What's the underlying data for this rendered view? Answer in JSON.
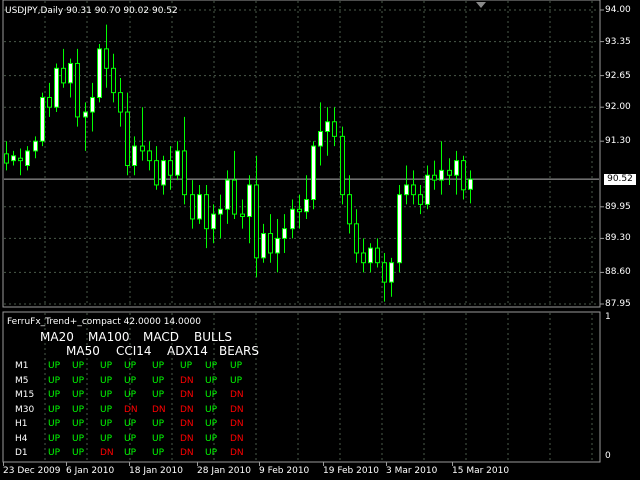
{
  "symbol_info": "USDJPY,Daily  90.31 90.70 90.02 90.52",
  "current_price": "90.52",
  "price_axis": [
    "94.00",
    "93.35",
    "92.65",
    "92.00",
    "91.30",
    "89.95",
    "89.30",
    "88.60",
    "87.95"
  ],
  "indicator": {
    "title": "FerruFx_Trend+_compact 42.0000 14.0000",
    "scale_top": "1",
    "scale_bottom": "0",
    "headers_row1": [
      "MA20",
      "MA100",
      "MACD",
      "BULLS"
    ],
    "headers_row2": [
      "MA50",
      "CCI14",
      "ADX14",
      "BEARS"
    ],
    "rows": [
      {
        "tf": "M1",
        "cells": [
          "UP",
          "UP",
          "UP",
          "UP",
          "UP",
          "UP",
          "UP",
          "UP"
        ]
      },
      {
        "tf": "M5",
        "cells": [
          "UP",
          "UP",
          "UP",
          "UP",
          "UP",
          "DN",
          "UP",
          "UP"
        ]
      },
      {
        "tf": "M15",
        "cells": [
          "UP",
          "UP",
          "UP",
          "UP",
          "UP",
          "DN",
          "UP",
          "DN"
        ]
      },
      {
        "tf": "M30",
        "cells": [
          "UP",
          "UP",
          "UP",
          "DN",
          "DN",
          "DN",
          "UP",
          "DN"
        ]
      },
      {
        "tf": "H1",
        "cells": [
          "UP",
          "UP",
          "UP",
          "UP",
          "UP",
          "DN",
          "UP",
          "DN"
        ]
      },
      {
        "tf": "H4",
        "cells": [
          "UP",
          "UP",
          "UP",
          "UP",
          "UP",
          "DN",
          "UP",
          "DN"
        ]
      },
      {
        "tf": "D1",
        "cells": [
          "UP",
          "UP",
          "DN",
          "UP",
          "UP",
          "DN",
          "UP",
          "DN"
        ]
      }
    ]
  },
  "time_axis": [
    "23 Dec 2009",
    "6 Jan 2010",
    "18 Jan 2010",
    "28 Jan 2010",
    "9 Feb 2010",
    "19 Feb 2010",
    "3 Mar 2010",
    "15 Mar 2010"
  ],
  "colors": {
    "background": "#000000",
    "grid": "#4a5a4a",
    "bull_candle": "#ffffff",
    "bear_candle": "#000000",
    "candle_wick": "#00ff00",
    "up": "#00ff00",
    "dn": "#ff0000",
    "text": "#ffffff"
  },
  "candles": [
    [
      91.04,
      91.3,
      90.7,
      90.85
    ],
    [
      90.9,
      91.1,
      90.8,
      91.0
    ],
    [
      90.95,
      91.15,
      90.6,
      90.9
    ],
    [
      90.8,
      91.2,
      90.7,
      91.1
    ],
    [
      91.1,
      91.4,
      90.95,
      91.3
    ],
    [
      91.3,
      92.3,
      91.2,
      92.2
    ],
    [
      92.2,
      92.5,
      91.8,
      92.0
    ],
    [
      92.0,
      92.9,
      91.9,
      92.8
    ],
    [
      92.8,
      93.2,
      92.4,
      92.5
    ],
    [
      92.5,
      93.0,
      92.2,
      92.9
    ],
    [
      92.9,
      93.2,
      91.6,
      91.8
    ],
    [
      91.8,
      92.1,
      91.1,
      91.9
    ],
    [
      91.9,
      92.5,
      91.5,
      92.2
    ],
    [
      92.2,
      93.3,
      92.1,
      93.2
    ],
    [
      93.2,
      93.7,
      92.4,
      92.8
    ],
    [
      92.8,
      93.1,
      92.1,
      92.3
    ],
    [
      92.3,
      92.6,
      91.6,
      91.9
    ],
    [
      91.9,
      92.3,
      90.6,
      90.8
    ],
    [
      90.8,
      91.4,
      90.6,
      91.2
    ],
    [
      91.2,
      92.0,
      90.9,
      91.1
    ],
    [
      91.1,
      91.3,
      90.7,
      90.9
    ],
    [
      90.9,
      91.2,
      90.3,
      90.4
    ],
    [
      90.4,
      91.0,
      90.2,
      90.9
    ],
    [
      90.9,
      91.2,
      90.3,
      90.6
    ],
    [
      90.6,
      91.3,
      90.5,
      91.1
    ],
    [
      91.1,
      91.8,
      90.0,
      90.2
    ],
    [
      90.2,
      90.5,
      89.5,
      89.7
    ],
    [
      89.7,
      90.4,
      89.6,
      90.2
    ],
    [
      90.2,
      90.4,
      89.1,
      89.5
    ],
    [
      89.5,
      90.0,
      89.2,
      89.8
    ],
    [
      89.8,
      90.2,
      89.3,
      89.9
    ],
    [
      89.9,
      90.7,
      89.6,
      90.5
    ],
    [
      90.5,
      91.1,
      89.7,
      89.8
    ],
    [
      89.8,
      90.1,
      89.5,
      89.75
    ],
    [
      89.75,
      90.6,
      89.2,
      90.4
    ],
    [
      90.4,
      91.0,
      88.5,
      88.9
    ],
    [
      88.9,
      89.6,
      88.8,
      89.4
    ],
    [
      89.4,
      89.8,
      88.8,
      89.0
    ],
    [
      89.0,
      89.7,
      88.6,
      89.3
    ],
    [
      89.3,
      89.8,
      89.0,
      89.5
    ],
    [
      89.5,
      90.1,
      89.3,
      89.9
    ],
    [
      89.9,
      90.2,
      89.5,
      89.85
    ],
    [
      89.85,
      90.6,
      89.7,
      90.1
    ],
    [
      90.1,
      91.3,
      89.9,
      91.2
    ],
    [
      91.2,
      92.1,
      90.8,
      91.5
    ],
    [
      91.5,
      92.0,
      91.0,
      91.7
    ],
    [
      91.7,
      92.0,
      91.2,
      91.4
    ],
    [
      91.4,
      91.6,
      90.0,
      90.2
    ],
    [
      90.2,
      90.6,
      89.4,
      89.6
    ],
    [
      89.6,
      89.9,
      88.8,
      89.0
    ],
    [
      89.0,
      89.3,
      88.6,
      88.8
    ],
    [
      88.8,
      89.2,
      88.6,
      89.1
    ],
    [
      89.1,
      89.3,
      88.7,
      88.8
    ],
    [
      88.8,
      89.0,
      88.0,
      88.4
    ],
    [
      88.4,
      88.9,
      88.1,
      88.8
    ],
    [
      88.8,
      90.4,
      88.6,
      90.2
    ],
    [
      90.2,
      90.8,
      90.0,
      90.4
    ],
    [
      90.4,
      90.7,
      90.0,
      90.2
    ],
    [
      90.2,
      90.4,
      89.8,
      90.0
    ],
    [
      90.0,
      90.8,
      89.9,
      90.6
    ],
    [
      90.6,
      90.9,
      90.3,
      90.5
    ],
    [
      90.5,
      91.3,
      90.2,
      90.7
    ],
    [
      90.7,
      90.95,
      90.4,
      90.6
    ],
    [
      90.6,
      91.1,
      90.2,
      90.9
    ],
    [
      90.9,
      91.0,
      90.1,
      90.3
    ],
    [
      90.31,
      90.7,
      90.02,
      90.52
    ]
  ]
}
